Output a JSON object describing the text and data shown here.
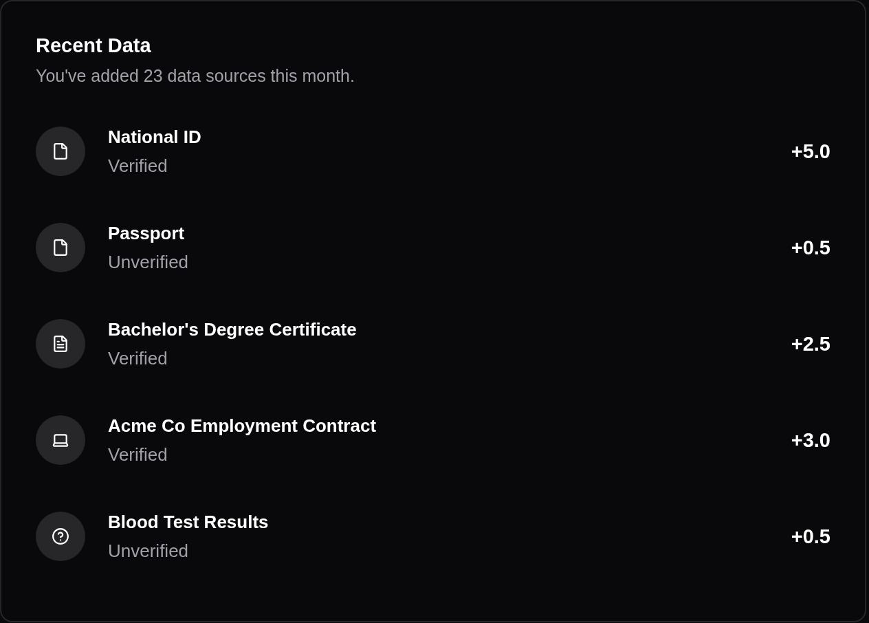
{
  "card": {
    "title": "Recent Data",
    "description": "You've added 23 data sources this month."
  },
  "items": [
    {
      "kind": "file",
      "name": "National ID",
      "status": "Verified",
      "score": "+5.0"
    },
    {
      "kind": "file",
      "name": "Passport",
      "status": "Unverified",
      "score": "+0.5"
    },
    {
      "kind": "file-text",
      "name": "Bachelor's Degree Certificate",
      "status": "Verified",
      "score": "+2.5"
    },
    {
      "kind": "laptop",
      "name": "Acme Co Employment Contract",
      "status": "Verified",
      "score": "+3.0"
    },
    {
      "kind": "help",
      "name": "Blood Test Results",
      "status": "Unverified",
      "score": "+0.5"
    }
  ]
}
